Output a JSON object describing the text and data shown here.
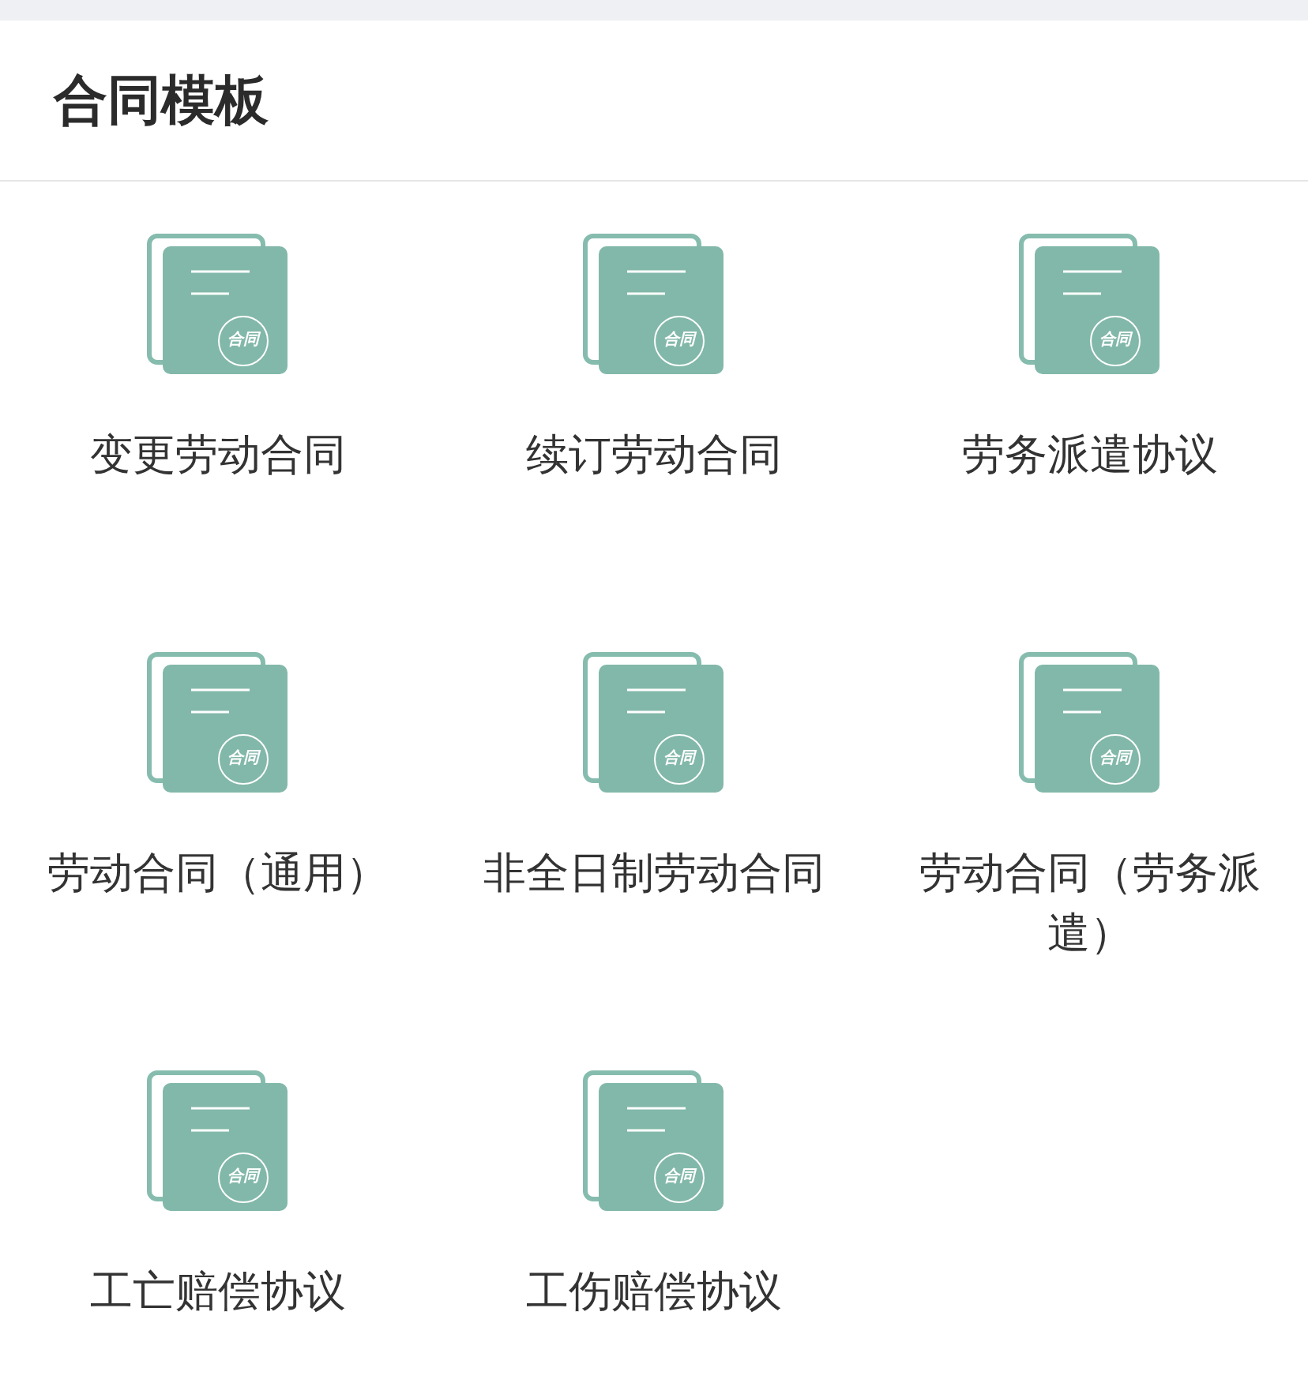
{
  "header": {
    "title": "合同模板"
  },
  "templates": [
    {
      "name": "变更劳动合同",
      "badge": "合同"
    },
    {
      "name": "续订劳动合同",
      "badge": "合同"
    },
    {
      "name": "劳务派遣协议",
      "badge": "合同"
    },
    {
      "name": "劳动合同（通用）",
      "badge": "合同"
    },
    {
      "name": "非全日制劳动合同",
      "badge": "合同"
    },
    {
      "name": "劳动合同（劳务派遣）",
      "badge": "合同"
    },
    {
      "name": "工亡赔偿协议",
      "badge": "合同"
    },
    {
      "name": "工伤赔偿协议",
      "badge": "合同"
    }
  ]
}
